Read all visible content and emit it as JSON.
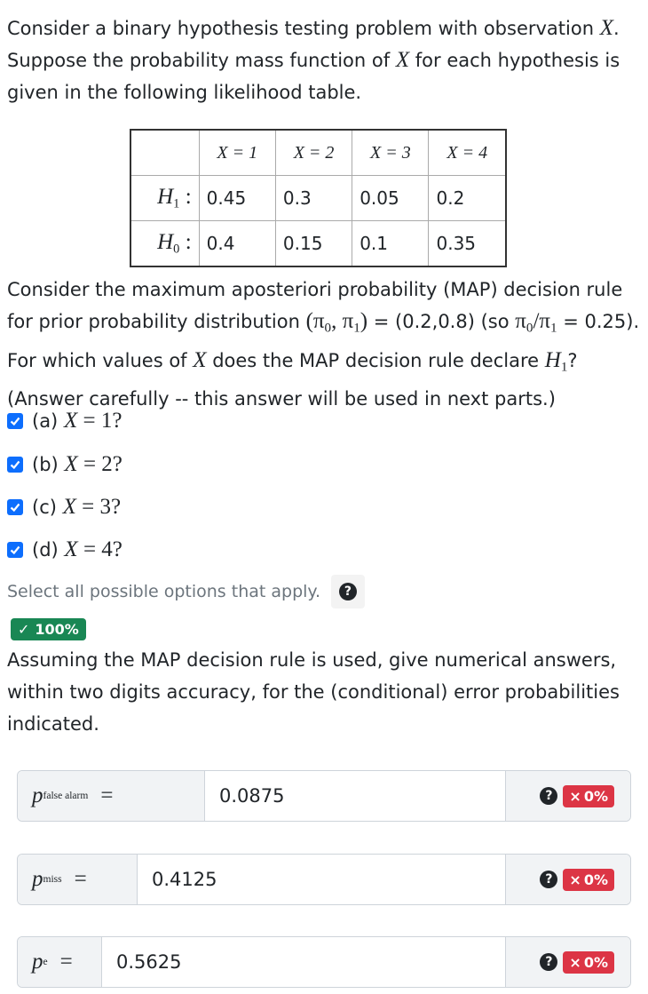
{
  "question": {
    "intro_a": "Consider a binary hypothesis testing problem with observation ",
    "var_x": "X",
    "intro_b": ". Suppose the probability mass function of ",
    "intro_c": " for each hypothesis is given in the following likelihood table."
  },
  "table": {
    "columns": [
      "X = 1",
      "X = 2",
      "X = 3",
      "X = 4"
    ],
    "rows": [
      {
        "label": "H",
        "sub": "1",
        "colon": ":",
        "values": [
          "0.45",
          "0.3",
          "0.05",
          "0.2"
        ]
      },
      {
        "label": "H",
        "sub": "0",
        "colon": ":",
        "values": [
          "0.4",
          "0.15",
          "0.1",
          "0.35"
        ]
      }
    ]
  },
  "map_question": {
    "a": "Consider the maximum aposteriori probability (MAP) decision rule for prior probability distribution ",
    "prior_math": "(π",
    "prior_math_sep": ", π",
    "prior_math_end": ")",
    "b": " = (0.2,0.8) (so ",
    "ratio_pi0": "π",
    "ratio_slash": "/π",
    "c": " = 0.25). For which values of ",
    "d": " does the MAP decision rule declare ",
    "h": "H",
    "e": "? (Answer carefully -- this answer will be used in next parts.)"
  },
  "choices": [
    {
      "prefix": "(a) ",
      "value": "1",
      "checked": true
    },
    {
      "prefix": "(b) ",
      "value": "2",
      "checked": true
    },
    {
      "prefix": "(c) ",
      "value": "3",
      "checked": true
    },
    {
      "prefix": "(d) ",
      "value": "4",
      "checked": true
    }
  ],
  "choice_eq": " = ",
  "choice_q": "?",
  "hint": {
    "text": "Select all possible options that apply.",
    "icon": "?"
  },
  "score_badge": {
    "check": "✓",
    "text": "100%"
  },
  "numeric_intro": "Assuming the MAP decision rule is used, give numerical answers, within two digits accuracy, for the (conditional) error probabilities indicated.",
  "answers": [
    {
      "var": "p",
      "sub": "false alarm",
      "eq": "=",
      "value": "0.0875",
      "help": "?",
      "x": "×",
      "score": "0%"
    },
    {
      "var": "p",
      "sub": "miss",
      "eq": "=",
      "value": "0.4125",
      "help": "?",
      "x": "×",
      "score": "0%"
    },
    {
      "var": "p",
      "sub": "e",
      "eq": "=",
      "value": "0.5625",
      "help": "?",
      "x": "×",
      "score": "0%"
    }
  ],
  "colors": {
    "checkbox": "#0d6efd",
    "success": "#198754",
    "danger": "#dc3545"
  }
}
